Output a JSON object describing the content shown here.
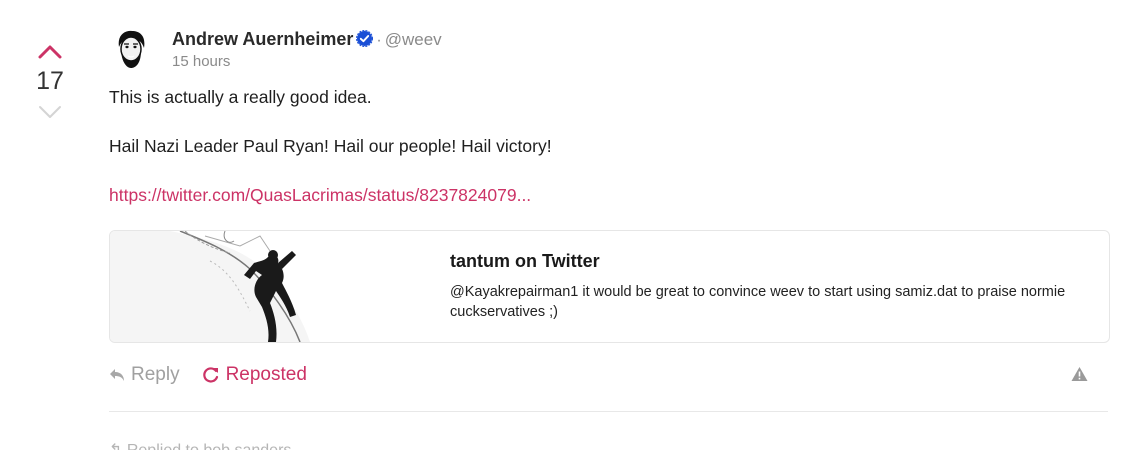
{
  "vote": {
    "count": "17",
    "upvote_color": "#cc3366",
    "downvote_color": "#d0d0d0"
  },
  "author": {
    "name": "Andrew Auernheimer",
    "separator": "·",
    "handle": "@weev",
    "time": "15 hours",
    "verified_icon": "verified-check-icon",
    "verified_color": "#1a4fd6"
  },
  "post": {
    "text_line1": "This is actually a really good idea.",
    "text_line2": "Hail Nazi Leader Paul Ryan! Hail our people! Hail victory!",
    "link": "https://twitter.com/QuasLacrimas/status/8237824079..."
  },
  "embed": {
    "title": "tantum on Twitter",
    "description": "@Kayakrepairman1 it would be great to convince weev to start using samiz.dat to praise normie cuckservatives ;)"
  },
  "actions": {
    "reply_label": "Reply",
    "repost_label": "Reposted",
    "accent_color": "#cc3366"
  },
  "next": {
    "text": "↰ Replied to bob sanders"
  }
}
